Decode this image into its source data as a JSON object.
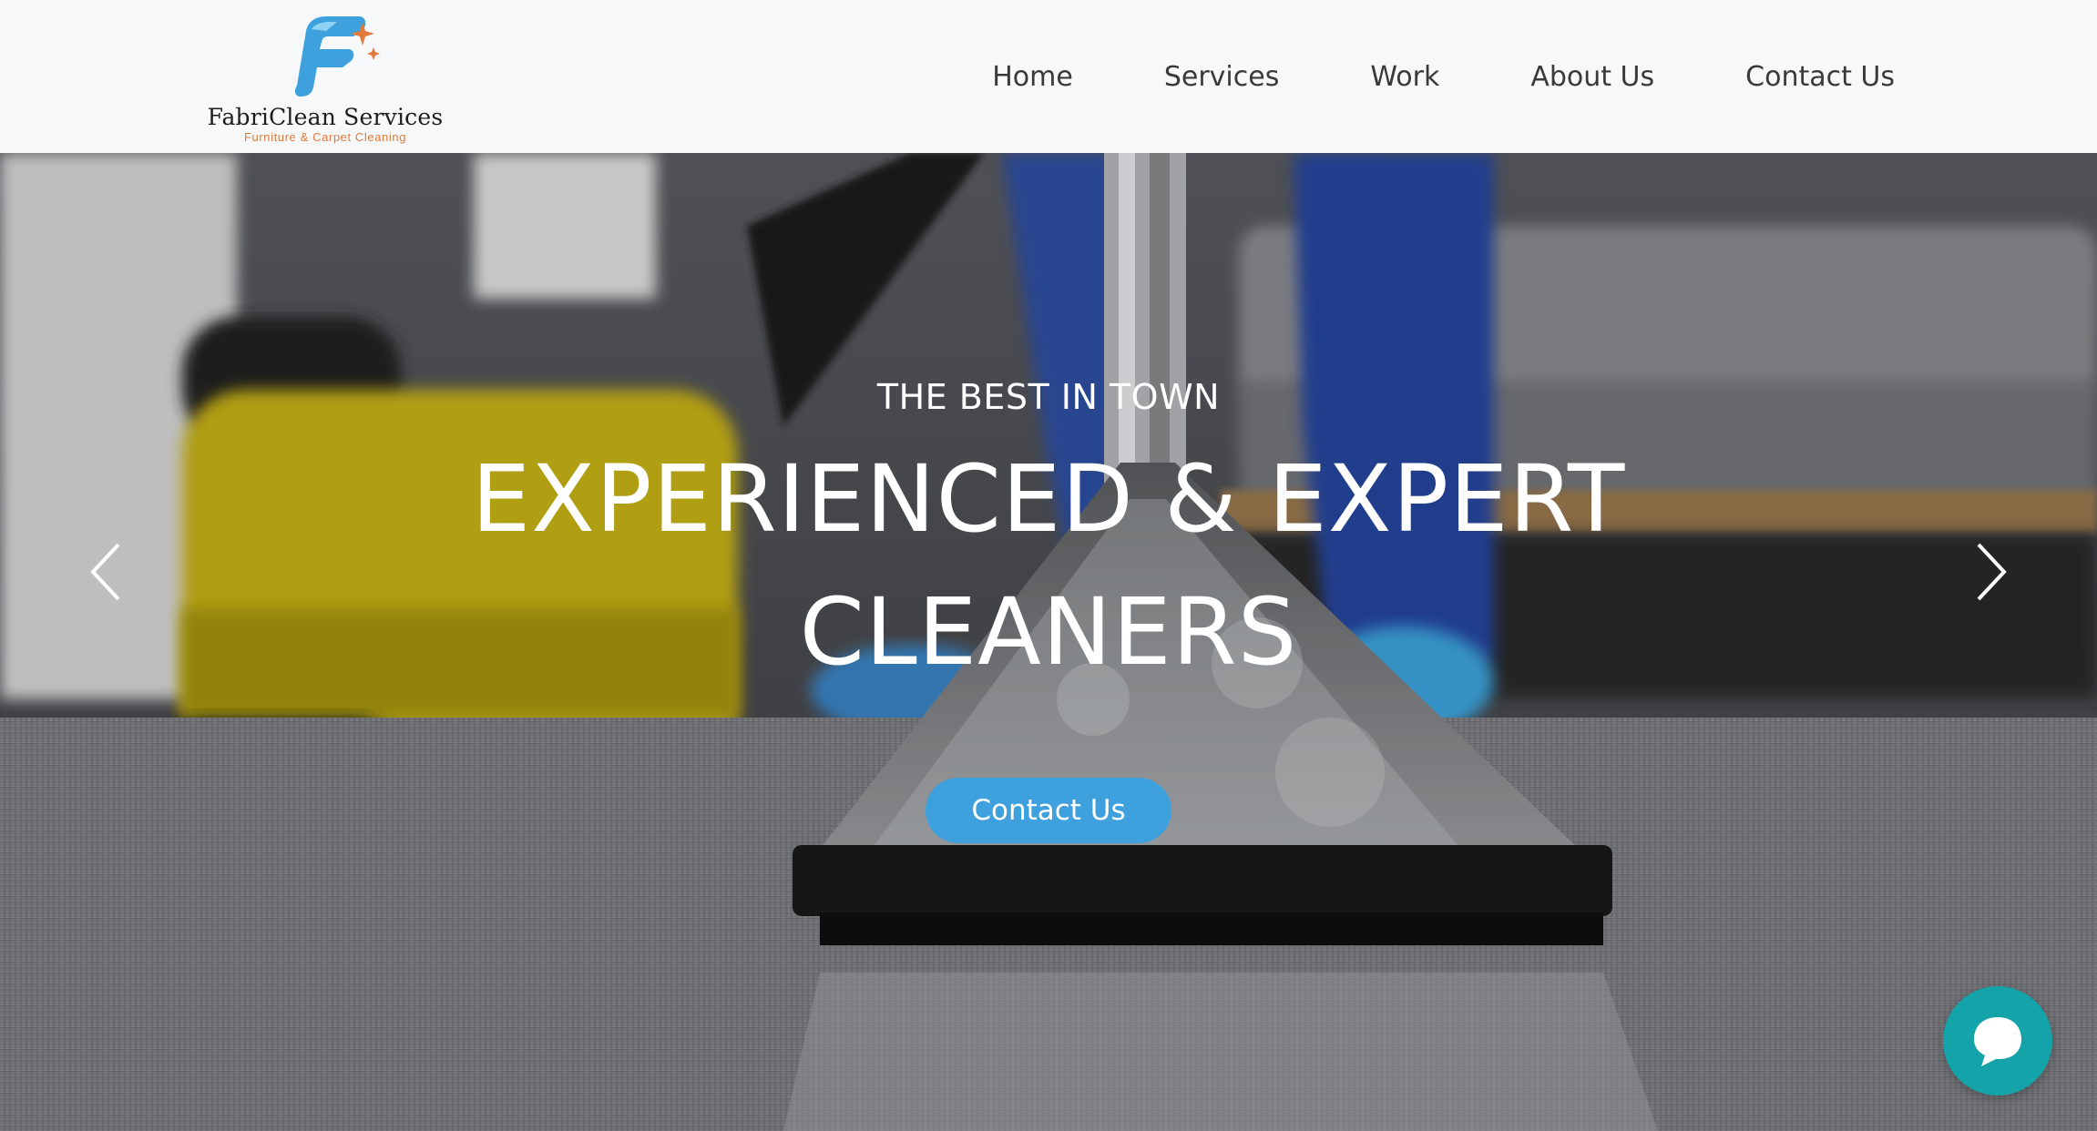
{
  "header": {
    "logo": {
      "name": "FabriClean Services",
      "tagline": "Furniture & Carpet Cleaning"
    },
    "nav": [
      {
        "label": "Home"
      },
      {
        "label": "Services"
      },
      {
        "label": "Work"
      },
      {
        "label": "About Us"
      },
      {
        "label": "Contact Us"
      }
    ]
  },
  "hero": {
    "eyebrow": "THE BEST IN TOWN",
    "headline_line1": "EXPERIENCED & EXPERT",
    "headline_line2": "CLEANERS",
    "cta_label": "Contact Us",
    "prev_icon": "chevron-left-icon",
    "next_icon": "chevron-right-icon"
  },
  "chat_widget": {
    "icon": "chat-bubble-icon"
  },
  "colors": {
    "accent_button": "#3ea1de",
    "chat_widget": "#14a3a8",
    "logo_blue": "#3ea1de",
    "logo_orange": "#e07a3a",
    "header_bg": "#f7f8fa",
    "nav_text": "#3a3a3a"
  }
}
